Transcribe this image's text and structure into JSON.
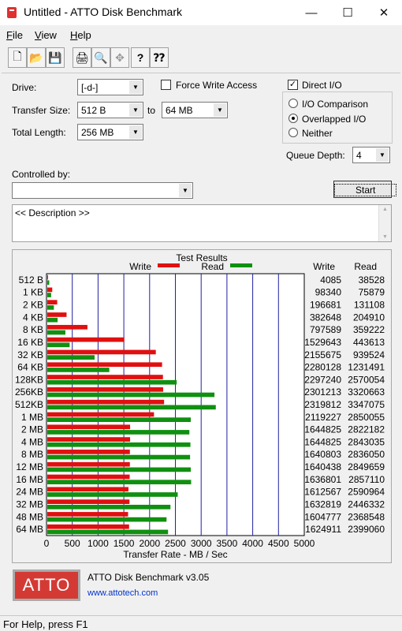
{
  "window": {
    "title": "Untitled - ATTO Disk Benchmark",
    "minimize": "—",
    "maximize": "☐",
    "close": "✕"
  },
  "menu": [
    {
      "label": "File",
      "u": "F"
    },
    {
      "label": "View",
      "u": "V"
    },
    {
      "label": "Help",
      "u": "H"
    }
  ],
  "toolbar": [
    {
      "name": "new-file-icon",
      "glyph": "🗋"
    },
    {
      "name": "open-folder-icon",
      "glyph": "📂"
    },
    {
      "name": "save-icon",
      "glyph": "💾"
    },
    {
      "name": "print-icon",
      "glyph": "🖨"
    },
    {
      "name": "print-preview-icon",
      "glyph": "🔍"
    },
    {
      "name": "move-icon",
      "glyph": "✥"
    },
    {
      "name": "help-icon",
      "glyph": "?"
    },
    {
      "name": "context-help-icon",
      "glyph": "⁇"
    }
  ],
  "settings": {
    "drive_label": "Drive:",
    "drive_value": "[-d-]",
    "force_write_access": "Force Write Access",
    "force_write_checked": false,
    "direct_io": "Direct I/O",
    "direct_io_checked": true,
    "transfer_size_label": "Transfer Size:",
    "transfer_from": "512 B",
    "to_label": "to",
    "transfer_to": "64 MB",
    "total_length_label": "Total Length:",
    "total_length_value": "256 MB",
    "io_comparison": "I/O Comparison",
    "overlapped_io": "Overlapped I/O",
    "neither": "Neither",
    "queue_depth_label": "Queue Depth:",
    "queue_depth_value": "4",
    "controlled_by_label": "Controlled by:",
    "controlled_by_value": "",
    "start_button": "Start",
    "description": "<< Description >>"
  },
  "results": {
    "title": "Test Results",
    "write_legend": "Write",
    "read_legend": "Read",
    "write_col": "Write",
    "read_col": "Read",
    "write_color": "#e01010",
    "read_color": "#109010"
  },
  "chart_data": {
    "type": "bar",
    "title": "Test Results",
    "xlabel": "Transfer Rate - MB / Sec",
    "xlim": [
      0,
      5000
    ],
    "xticks": [
      0,
      500,
      1000,
      1500,
      2000,
      2500,
      3000,
      3500,
      4000,
      4500,
      5000
    ],
    "categories": [
      "512 B",
      "1 KB",
      "2 KB",
      "4 KB",
      "8 KB",
      "16 KB",
      "32 KB",
      "64 KB",
      "128KB",
      "256KB",
      "512KB",
      "1 MB",
      "2 MB",
      "4 MB",
      "8 MB",
      "12 MB",
      "16 MB",
      "24 MB",
      "32 MB",
      "48 MB",
      "64 MB"
    ],
    "series": [
      {
        "name": "Write",
        "color": "#e01010",
        "values": [
          4085,
          98340,
          196681,
          382648,
          797589,
          1529643,
          2155675,
          2280128,
          2297240,
          2301213,
          2319812,
          2119227,
          1644825,
          1644825,
          1640803,
          1640438,
          1636801,
          1612567,
          1632819,
          1604777,
          1624911
        ]
      },
      {
        "name": "Read",
        "color": "#109010",
        "values": [
          38528,
          75879,
          131108,
          204910,
          359222,
          443613,
          939524,
          1231491,
          2570054,
          3320663,
          3347075,
          2850055,
          2822182,
          2843035,
          2836050,
          2849659,
          2857110,
          2590964,
          2446332,
          2368548,
          2399060
        ]
      }
    ],
    "grid": true,
    "legend": "top"
  },
  "footer": {
    "logo": "ATTO",
    "version": "ATTO Disk Benchmark v3.05",
    "url": "www.attotech.com"
  },
  "status": "For Help, press F1"
}
